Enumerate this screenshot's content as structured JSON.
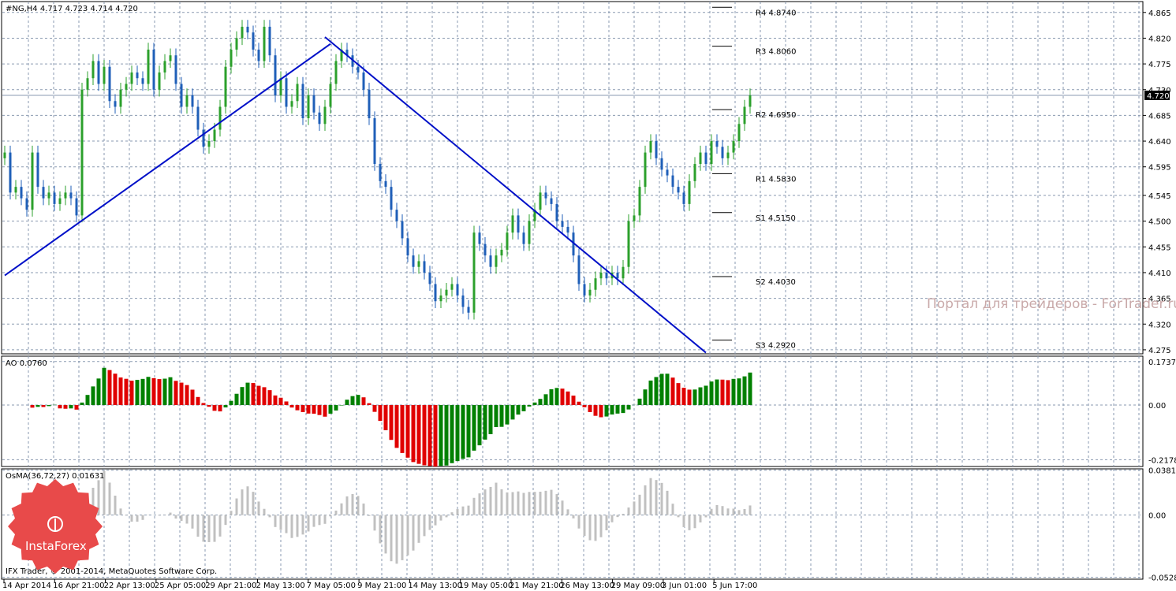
{
  "header": {
    "symbol_line": "#NG,H4  4.717 4.723 4.714 4.720",
    "ao_label": "AO 0.0760",
    "osma_label": "OsMA(36,72,27) 0.01631",
    "copyright": "IFX Trader, © 2001-2014, MetaQuotes Software Corp.",
    "watermark": "Портал для трейдеров - ForTrader.ru",
    "logo_text": "InstaForex"
  },
  "colors": {
    "bull": "#2ca02c",
    "bear": "#1f5fb8",
    "trendline": "#0010c8",
    "ao_up": "#008000",
    "ao_down": "#e00000",
    "osma": "#c0c0c0",
    "grid": "#8a9ab0",
    "logo": "#e84a4a"
  },
  "chart_data": [
    {
      "type": "candlestick",
      "title": "#NG,H4",
      "ohlc_last": {
        "open": 4.717,
        "high": 4.723,
        "low": 4.714,
        "close": 4.72
      },
      "current_price_label": "4.720",
      "y_ticks": [
        "4.865",
        "4.820",
        "4.775",
        "4.730",
        "4.685",
        "4.640",
        "4.595",
        "4.545",
        "4.500",
        "4.455",
        "4.410",
        "4.365",
        "4.320",
        "4.275"
      ],
      "ylim": [
        4.268,
        4.884
      ],
      "x_ticks": [
        "14 Apr 2014",
        "16 Apr 21:00",
        "22 Apr 13:00",
        "25 Apr 05:00",
        "29 Apr 21:00",
        "2 May 13:00",
        "7 May 05:00",
        "9 May 21:00",
        "14 May 13:00",
        "19 May 05:00",
        "21 May 21:00",
        "26 May 13:00",
        "29 May 09:00",
        "3 Jun 01:00",
        "5 Jun 17:00"
      ],
      "closes": [
        4.62,
        4.55,
        4.56,
        4.54,
        4.52,
        4.62,
        4.56,
        4.54,
        4.55,
        4.53,
        4.54,
        4.55,
        4.54,
        4.51,
        4.73,
        4.75,
        4.78,
        4.74,
        4.77,
        4.71,
        4.7,
        4.73,
        4.74,
        4.76,
        4.75,
        4.74,
        4.8,
        4.73,
        4.76,
        4.78,
        4.79,
        4.74,
        4.7,
        4.72,
        4.7,
        4.66,
        4.63,
        4.64,
        4.66,
        4.7,
        4.77,
        4.8,
        4.82,
        4.84,
        4.83,
        4.8,
        4.78,
        4.84,
        4.79,
        4.72,
        4.75,
        4.7,
        4.71,
        4.74,
        4.68,
        4.72,
        4.69,
        4.67,
        4.7,
        4.74,
        4.78,
        4.8,
        4.79,
        4.77,
        4.76,
        4.73,
        4.68,
        4.6,
        4.57,
        4.56,
        4.52,
        4.5,
        4.47,
        4.44,
        4.42,
        4.43,
        4.41,
        4.39,
        4.36,
        4.37,
        4.38,
        4.39,
        4.37,
        4.35,
        4.34,
        4.48,
        4.46,
        4.44,
        4.42,
        4.44,
        4.45,
        4.48,
        4.51,
        4.48,
        4.46,
        4.5,
        4.52,
        4.55,
        4.54,
        4.53,
        4.5,
        4.49,
        4.48,
        4.44,
        4.39,
        4.37,
        4.38,
        4.4,
        4.41,
        4.4,
        4.41,
        4.4,
        4.42,
        4.5,
        4.51,
        4.56,
        4.62,
        4.64,
        4.61,
        4.59,
        4.58,
        4.56,
        4.55,
        4.53,
        4.57,
        4.6,
        4.62,
        4.6,
        4.64,
        4.63,
        4.61,
        4.62,
        4.64,
        4.67,
        4.7,
        4.72
      ],
      "pivots": [
        {
          "label": "R4 4.8740",
          "value": 4.874
        },
        {
          "label": "R3 4.8060",
          "value": 4.806
        },
        {
          "label": "R2 4.6950",
          "value": 4.695
        },
        {
          "label": "R1 4.5830",
          "value": 4.583
        },
        {
          "label": "S1 4.5150",
          "value": 4.515
        },
        {
          "label": "S2 4.4030",
          "value": 4.403
        },
        {
          "label": "S3 4.2920",
          "value": 4.292
        }
      ],
      "trendlines": [
        {
          "name": "support",
          "from_bar": 0,
          "from_price": 4.405,
          "to_bar": 59,
          "to_price": 4.81
        },
        {
          "name": "resistance",
          "from_bar": 58,
          "from_price": 4.822,
          "to_bar": 127,
          "to_price": 4.27
        }
      ]
    },
    {
      "type": "bar",
      "title": "AO",
      "value_label": "0.0760",
      "y_ticks": [
        "0.1737",
        "0.00",
        "-0.2178"
      ],
      "ylim": [
        -0.245,
        0.195
      ]
    },
    {
      "type": "bar",
      "title": "OsMA(36,72,27)",
      "value_label": "0.01631",
      "y_ticks": [
        "0.03814",
        "0.00",
        "-0.05287"
      ],
      "ylim": [
        -0.0545,
        0.0392
      ]
    }
  ]
}
